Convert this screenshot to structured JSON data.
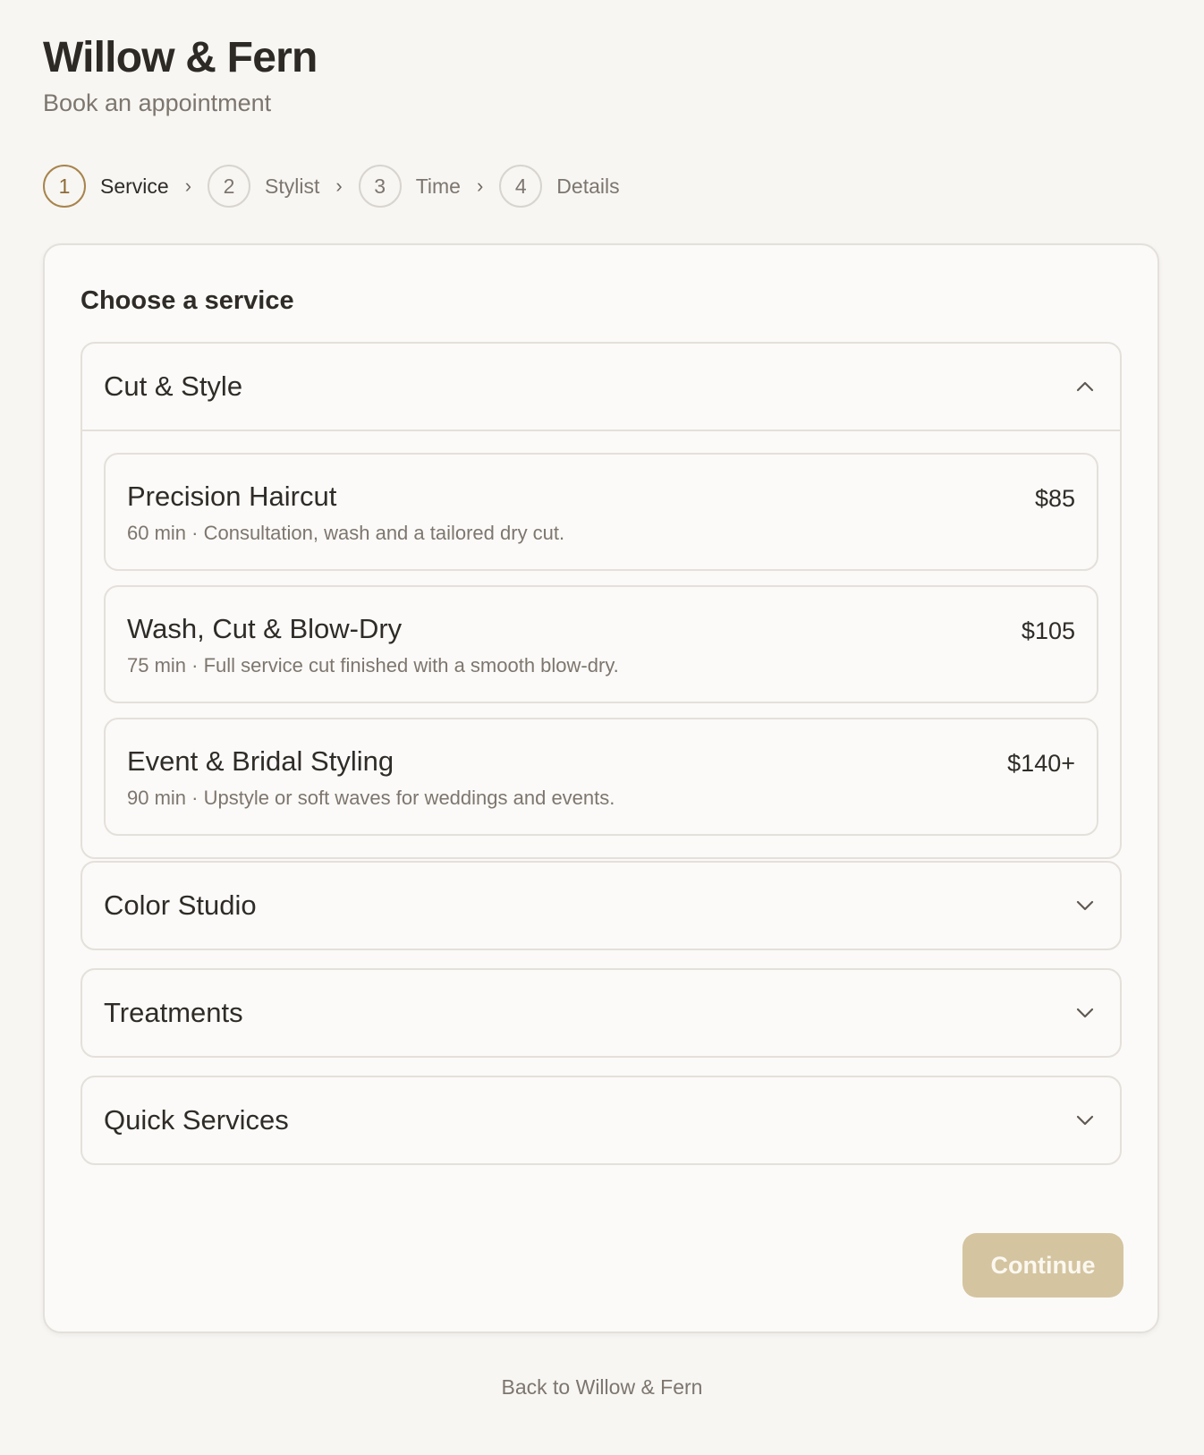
{
  "brand": "Willow & Fern",
  "subtitle": "Book an appointment",
  "steps": [
    {
      "number": "1",
      "label": "Service",
      "active": true
    },
    {
      "number": "2",
      "label": "Stylist",
      "active": false
    },
    {
      "number": "3",
      "label": "Time",
      "active": false
    },
    {
      "number": "4",
      "label": "Details",
      "active": false
    }
  ],
  "step_separator": "›",
  "card": {
    "title": "Choose a service",
    "categories": [
      {
        "title": "Cut & Style",
        "expanded": true,
        "services": [
          {
            "name": "Precision Haircut",
            "desc": "60 min · Consultation, wash and a tailored dry cut.",
            "price": "$85"
          },
          {
            "name": "Wash, Cut & Blow-Dry",
            "desc": "75 min · Full service cut finished with a smooth blow-dry.",
            "price": "$105"
          },
          {
            "name": "Event & Bridal Styling",
            "desc": "90 min · Upstyle or soft waves for weddings and events.",
            "price": "$140+"
          }
        ]
      },
      {
        "title": "Color Studio",
        "expanded": false
      },
      {
        "title": "Treatments",
        "expanded": false
      },
      {
        "title": "Quick Services",
        "expanded": false
      }
    ],
    "continue_label": "Continue"
  },
  "back_link": "Back to Willow & Fern",
  "colors": {
    "background": "#f7f6f3",
    "accent": "#a8844c",
    "continue_disabled": "#d4c4a0"
  },
  "icons": {
    "expanded": "chevron-up-icon",
    "collapsed": "chevron-down-icon"
  }
}
